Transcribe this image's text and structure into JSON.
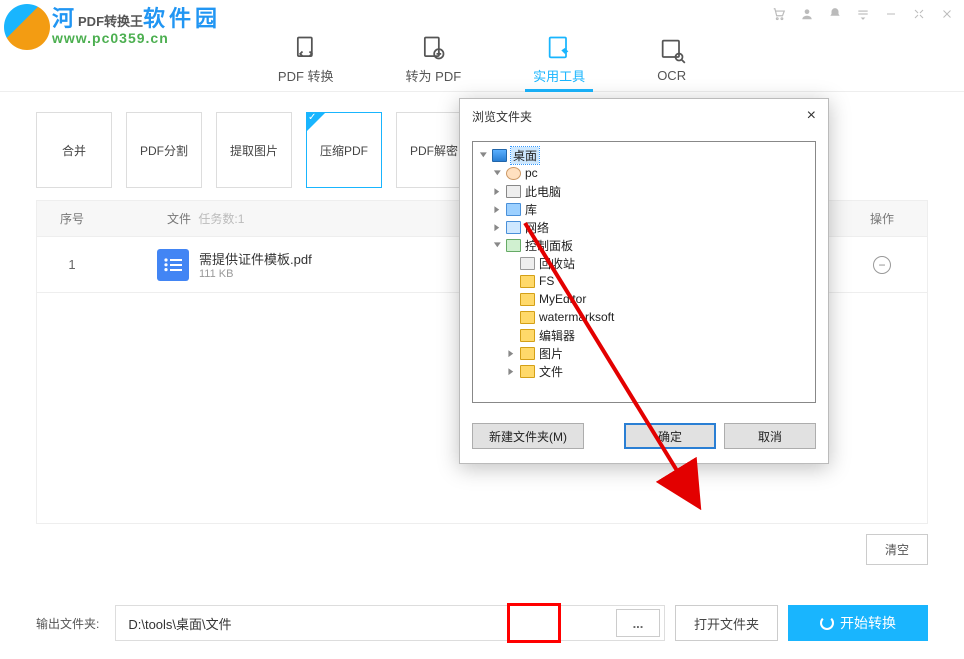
{
  "watermark": {
    "brand_part": "河",
    "app_title": "PDF转换王",
    "brand_rest": "软件园",
    "url": "www.pc0359.cn"
  },
  "tabs": [
    {
      "label": "PDF 转换"
    },
    {
      "label": "转为 PDF"
    },
    {
      "label": "实用工具"
    },
    {
      "label": "OCR"
    }
  ],
  "tools": [
    {
      "label": "合并"
    },
    {
      "label": "PDF分割"
    },
    {
      "label": "提取图片"
    },
    {
      "label": "压缩PDF"
    },
    {
      "label": "PDF解密"
    }
  ],
  "table": {
    "headers": {
      "idx": "序号",
      "file": "文件",
      "tasks_label": "任务数:",
      "tasks_count": "1",
      "op": "操作"
    },
    "rows": [
      {
        "idx": "1",
        "name": "需提供证件模板.pdf",
        "size": "111 KB"
      }
    ]
  },
  "clear_btn": "清空",
  "footer": {
    "label": "输出文件夹:",
    "path": "D:\\tools\\桌面\\文件",
    "browse": "...",
    "open": "打开文件夹",
    "start": "开始转换"
  },
  "dialog": {
    "title": "浏览文件夹",
    "close": "×",
    "tree": [
      {
        "label": "桌面",
        "expanded": true,
        "icon": "mon",
        "sel": true,
        "indent": 0
      },
      {
        "label": "pc",
        "expanded": true,
        "icon": "user",
        "indent": 1
      },
      {
        "label": "此电脑",
        "expanded": false,
        "icon": "pc",
        "indent": 1
      },
      {
        "label": "库",
        "expanded": false,
        "icon": "lib",
        "indent": 1
      },
      {
        "label": "网络",
        "expanded": false,
        "icon": "net",
        "indent": 1
      },
      {
        "label": "控制面板",
        "expanded": true,
        "icon": "cp",
        "indent": 1
      },
      {
        "label": "回收站",
        "icon": "bin",
        "indent": 2
      },
      {
        "label": "FS",
        "icon": "fold",
        "indent": 2
      },
      {
        "label": "MyEditor",
        "icon": "fold",
        "indent": 2
      },
      {
        "label": "watermarksoft",
        "icon": "fold",
        "indent": 2
      },
      {
        "label": "编辑器",
        "icon": "fold",
        "indent": 2
      },
      {
        "label": "图片",
        "expanded": false,
        "icon": "fold",
        "indent": 2
      },
      {
        "label": "文件",
        "expanded": false,
        "icon": "fold",
        "indent": 2
      }
    ],
    "new_folder": "新建文件夹(M)",
    "ok": "确定",
    "cancel": "取消"
  }
}
